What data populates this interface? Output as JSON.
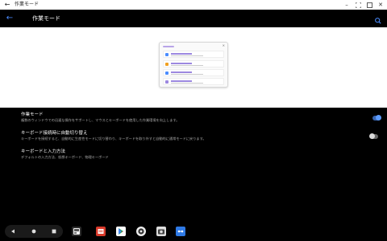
{
  "window": {
    "title": "作業モード"
  },
  "appbar": {
    "title": "作業モード"
  },
  "settings": {
    "items": [
      {
        "title": "作業モード",
        "description": "複数のウィンドウでの迅速な操作をサポートし、マウスとキーボードを使用した作業環境を向上します。",
        "toggle_on": true
      },
      {
        "title": "キーボード接続時に自動切り替え",
        "description": "キーボードを接続すると、自動的に生産性モードに切り替わり、キーボードを取り外すと自動的に通常モードに戻ります。",
        "toggle_on": false
      },
      {
        "title": "キーボードと入力方法",
        "description": "デフォルトの入力方法、仮想キーボード、物理キーボード"
      }
    ]
  },
  "taskbar": {
    "apps": [
      "gallery-app",
      "notes-app",
      "play-store-app",
      "settings-app",
      "camera-app",
      "files-app"
    ]
  },
  "colors": {
    "accent": "#4a8cff",
    "toggle_on": "#5d9cff"
  }
}
